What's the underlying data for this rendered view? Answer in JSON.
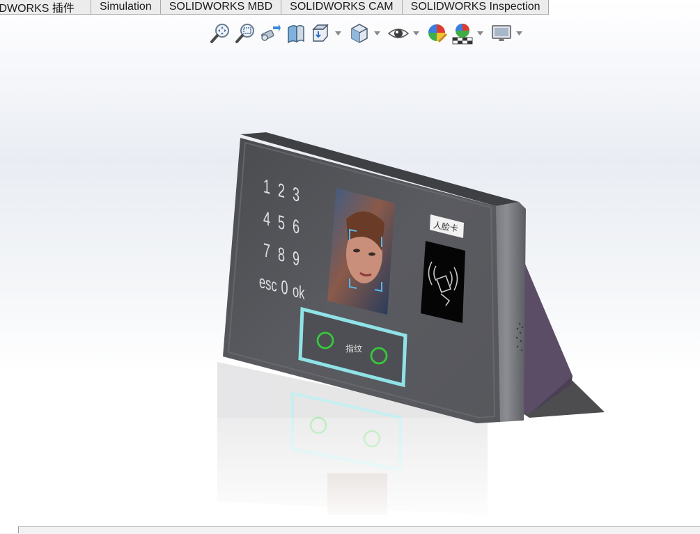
{
  "command_manager": {
    "tabs": [
      {
        "label": "IDWORKS 插件"
      },
      {
        "label": "Simulation"
      },
      {
        "label": "SOLIDWORKS MBD"
      },
      {
        "label": "SOLIDWORKS CAM"
      },
      {
        "label": "SOLIDWORKS Inspection"
      }
    ]
  },
  "heads_up_toolbar": {
    "tools": [
      {
        "icon": "zoom-to-fit-icon"
      },
      {
        "icon": "zoom-to-area-icon"
      },
      {
        "icon": "previous-view-icon"
      },
      {
        "icon": "section-view-icon"
      },
      {
        "icon": "view-orientation-icon"
      },
      {
        "icon": "display-style-icon"
      },
      {
        "icon": "hide-show-items-icon"
      },
      {
        "icon": "edit-appearance-icon"
      },
      {
        "icon": "apply-scene-icon"
      },
      {
        "icon": "view-settings-icon"
      }
    ]
  },
  "model": {
    "keypad": {
      "rows": [
        [
          "1",
          "2",
          "3"
        ],
        [
          "4",
          "5",
          "6"
        ],
        [
          "7",
          "8",
          "9"
        ],
        [
          "esc",
          "0",
          "ok"
        ]
      ]
    },
    "card_label": "人脸卡",
    "fingerprint_label": "指纹",
    "colors": {
      "panel": "#55565a",
      "accent_frame": "#8fe3e6",
      "fingerprint_ring": "#37c83b",
      "stand": "#4a3f53"
    }
  }
}
